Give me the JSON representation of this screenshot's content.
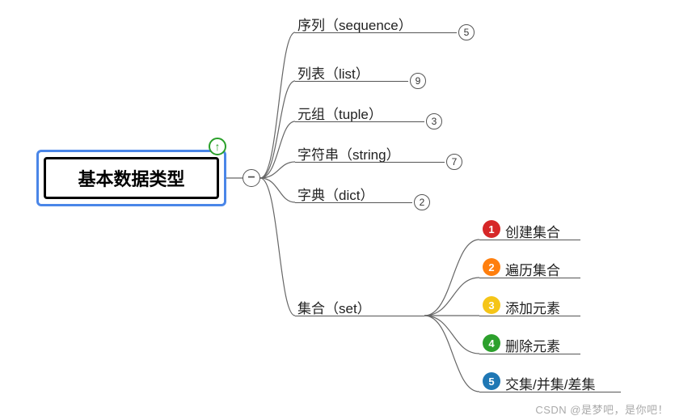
{
  "root": {
    "label": "基本数据类型"
  },
  "collapse": {
    "symbol": "−"
  },
  "arrow": {
    "glyph": "↑"
  },
  "children": [
    {
      "label": "序列（sequence）",
      "count": "5"
    },
    {
      "label": "列表（list）",
      "count": "9"
    },
    {
      "label": "元组（tuple）",
      "count": "3"
    },
    {
      "label": "字符串（string）",
      "count": "7"
    },
    {
      "label": "字典（dict）",
      "count": "2"
    },
    {
      "label": "集合（set）",
      "count": null
    }
  ],
  "leaves": [
    {
      "num": "1",
      "label": "创建集合",
      "color": "#d62728"
    },
    {
      "num": "2",
      "label": "遍历集合",
      "color": "#ff7f0e"
    },
    {
      "num": "3",
      "label": "添加元素",
      "color": "#f5c518"
    },
    {
      "num": "4",
      "label": "删除元素",
      "color": "#2ca02c"
    },
    {
      "num": "5",
      "label": "交集/并集/差集",
      "color": "#1f77b4"
    }
  ],
  "watermark": "CSDN @是梦吧，是你吧！"
}
